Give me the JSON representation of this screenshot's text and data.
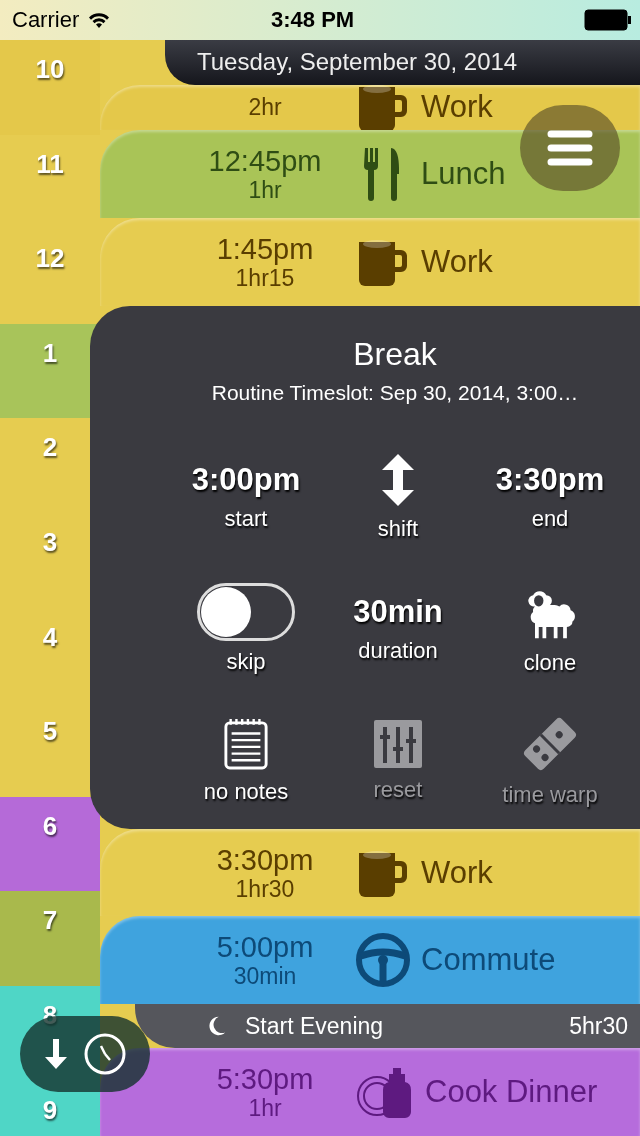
{
  "status_bar": {
    "carrier": "Carrier",
    "time": "3:48 PM"
  },
  "date": "Tuesday, September 30, 2014",
  "hours": [
    {
      "label": "10",
      "color": "#e4c84a"
    },
    {
      "label": "11",
      "color": "#e6cc50"
    },
    {
      "label": "12",
      "color": "#e6cc50"
    },
    {
      "label": "1",
      "color": "#a8c45a"
    },
    {
      "label": "2",
      "color": "#e6cc50"
    },
    {
      "label": "3",
      "color": "#e6cc50"
    },
    {
      "label": "4",
      "color": "#e6cc50"
    },
    {
      "label": "5",
      "color": "#e6cc50"
    },
    {
      "label": "6",
      "color": "#b56ad8"
    },
    {
      "label": "7",
      "color": "#a9b94c"
    },
    {
      "label": "8",
      "color": "#4fd6c6"
    },
    {
      "label": "9",
      "color": "#4fd6c6"
    }
  ],
  "events_before": [
    {
      "kind": "work",
      "duration": "2hr",
      "label": "Work",
      "color": "#e4c84a"
    },
    {
      "kind": "lunch",
      "time": "12:45pm",
      "duration": "1hr",
      "label": "Lunch",
      "color": "#a9c457"
    },
    {
      "kind": "work",
      "time": "1:45pm",
      "duration": "1hr15",
      "label": "Work",
      "color": "#e6cc50"
    }
  ],
  "detail": {
    "title": "Break",
    "subtitle": "Routine Timeslot: Sep 30, 2014, 3:00…",
    "controls": [
      {
        "kind": "value",
        "value": "3:00pm",
        "label": "start",
        "disabled": false
      },
      {
        "kind": "shift",
        "label": "shift",
        "disabled": false
      },
      {
        "kind": "value",
        "value": "3:30pm",
        "label": "end",
        "disabled": false
      },
      {
        "kind": "toggle",
        "on": false,
        "label": "skip",
        "disabled": false
      },
      {
        "kind": "value",
        "value": "30min",
        "label": "duration",
        "disabled": false
      },
      {
        "kind": "clone",
        "label": "clone",
        "disabled": false
      },
      {
        "kind": "notes",
        "label": "no notes",
        "disabled": false
      },
      {
        "kind": "reset",
        "label": "reset",
        "disabled": true
      },
      {
        "kind": "warp",
        "label": "time warp",
        "disabled": true
      }
    ]
  },
  "events_after": [
    {
      "kind": "work",
      "time": "3:30pm",
      "duration": "1hr30",
      "label": "Work",
      "color": "#e6cc50"
    },
    {
      "kind": "commute",
      "time": "5:00pm",
      "duration": "30min",
      "label": "Commute",
      "color": "#3fa3de"
    },
    {
      "kind": "divider",
      "label": "Start Evening",
      "duration": "5hr30",
      "color": "#55565c"
    },
    {
      "kind": "cooking",
      "time": "5:30pm",
      "duration": "1hr",
      "label": "Cook Dinner",
      "color": "#b66cdc"
    }
  ]
}
